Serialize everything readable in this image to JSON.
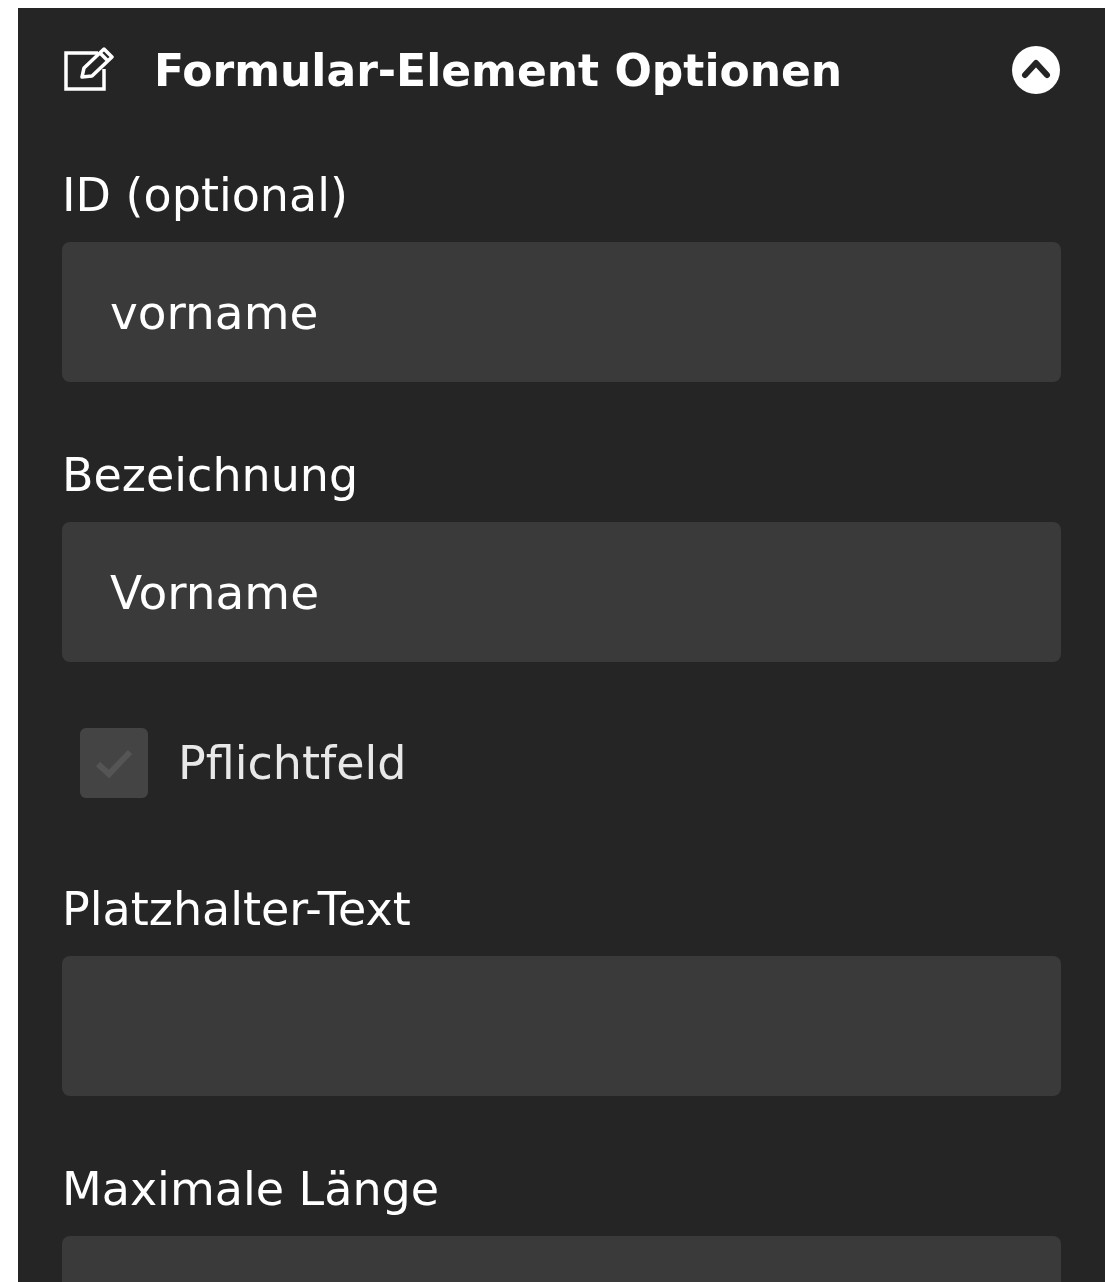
{
  "panel": {
    "title": "Formular-Element Optionen",
    "expanded": true
  },
  "fields": [
    {
      "kind": "text",
      "label": "ID (optional)",
      "value": "vorname"
    },
    {
      "kind": "text",
      "label": "Bezeichnung",
      "value": "Vorname"
    },
    {
      "kind": "checkbox",
      "label": "Pflichtfeld",
      "checked": true,
      "disabled": true
    },
    {
      "kind": "text",
      "label": "Platzhalter-Text"
    },
    {
      "kind": "text",
      "label": "Maximale Länge"
    }
  ]
}
